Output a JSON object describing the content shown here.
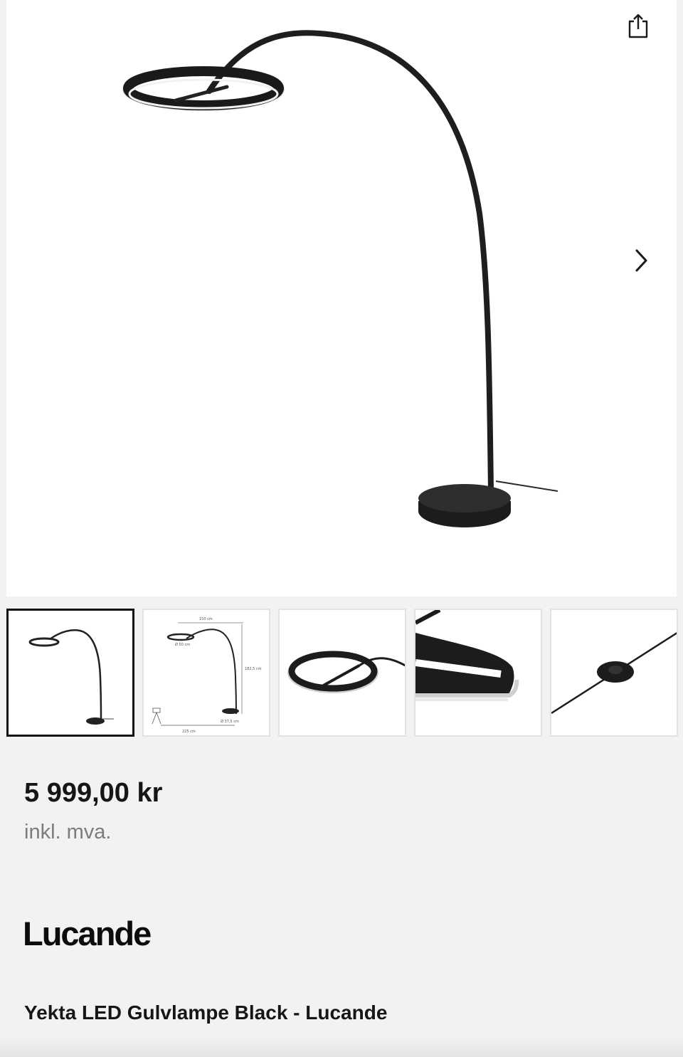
{
  "gallery": {
    "share_icon": "share-icon",
    "next_icon": "chevron-right-icon",
    "thumbnails": [
      {
        "subject": "full-lamp"
      },
      {
        "subject": "dimension-drawing",
        "labels": [
          "150 cm",
          "Ø 50 cm",
          "182,5 cm",
          "Ø 37,5 cm",
          "225 cm"
        ]
      },
      {
        "subject": "ring-closeup"
      },
      {
        "subject": "ring-detail"
      },
      {
        "subject": "cable-switch"
      }
    ],
    "active_index": 0
  },
  "product": {
    "price": "5 999,00 kr",
    "vat_note": "inkl. mva.",
    "brand": "Lucande",
    "name": "Yekta LED Gulvlampe Black - Lucande"
  }
}
